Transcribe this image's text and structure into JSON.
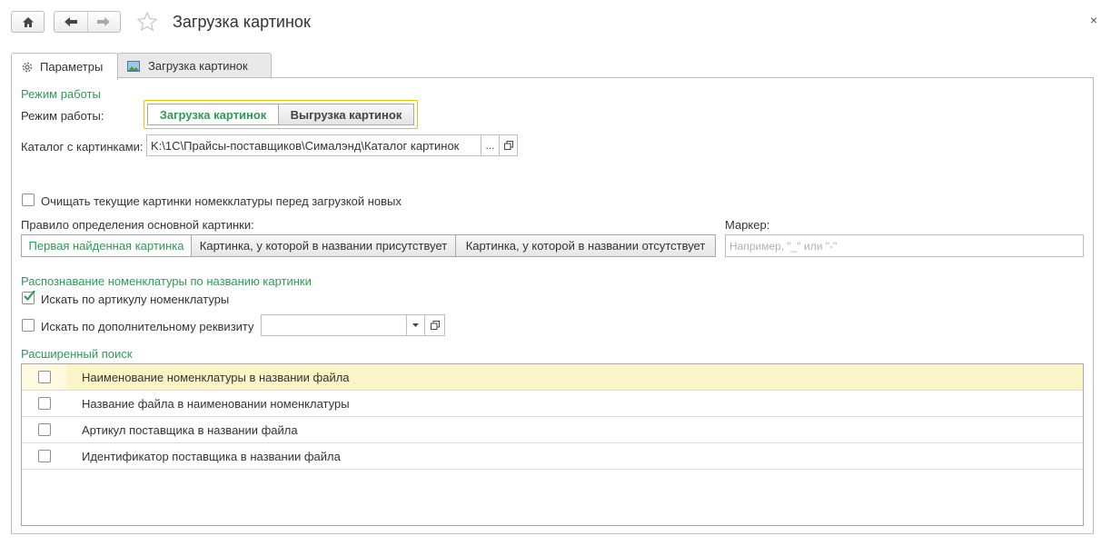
{
  "window": {
    "title": "Загрузка картинок",
    "close_glyph": "×"
  },
  "tabs": [
    {
      "label": "Параметры",
      "icon": "gear-icon",
      "active": true
    },
    {
      "label": "Загрузка картинок",
      "icon": "picture-icon",
      "active": false
    }
  ],
  "mode": {
    "section": "Режим работы",
    "label": "Режим работы:",
    "options": [
      "Загрузка картинок",
      "Выгрузка картинок"
    ],
    "selected": "Загрузка картинок"
  },
  "catalog": {
    "label": "Каталог с картинками:",
    "value": "K:\\1C\\Прайсы-поставщиков\\Сималэнд\\Каталог картинок",
    "select_btn": "..."
  },
  "clear_current": {
    "label": "Очищать текущие картинки номекклатуры перед загрузкой новых",
    "checked": false
  },
  "rule": {
    "label": "Правило определения основной картинки:",
    "options": [
      "Первая найденная картинка",
      "Картинка, у которой в названии присутствует",
      "Картинка, у которой в названии отсутствует"
    ],
    "selected": "Первая найденная картинка"
  },
  "marker": {
    "label": "Маркер:",
    "placeholder": "Например, \"_\" или \"-\"",
    "value": ""
  },
  "recognition": {
    "section": "Распознавание номенклатуры по названию картинки",
    "by_article": {
      "label": "Искать по артикулу номенклатуры",
      "checked": true
    },
    "by_extra": {
      "label": "Искать по дополнительному реквизиту",
      "checked": false,
      "value": ""
    }
  },
  "extended": {
    "section": "Расширенный поиск",
    "rows": [
      {
        "label": "Наименование номенклатуры в названии файла",
        "checked": false,
        "highlighted": true
      },
      {
        "label": "Название файла в наименовании номенклатуры",
        "checked": false,
        "highlighted": false
      },
      {
        "label": "Артикул поставщика в названии файла",
        "checked": false,
        "highlighted": false
      },
      {
        "label": "Идентификатор поставщика в названии файла",
        "checked": false,
        "highlighted": false
      }
    ]
  },
  "colors": {
    "accent_green": "#2f9a55",
    "highlight_row": "#fbf4c6",
    "focus_border": "#e6c800"
  }
}
